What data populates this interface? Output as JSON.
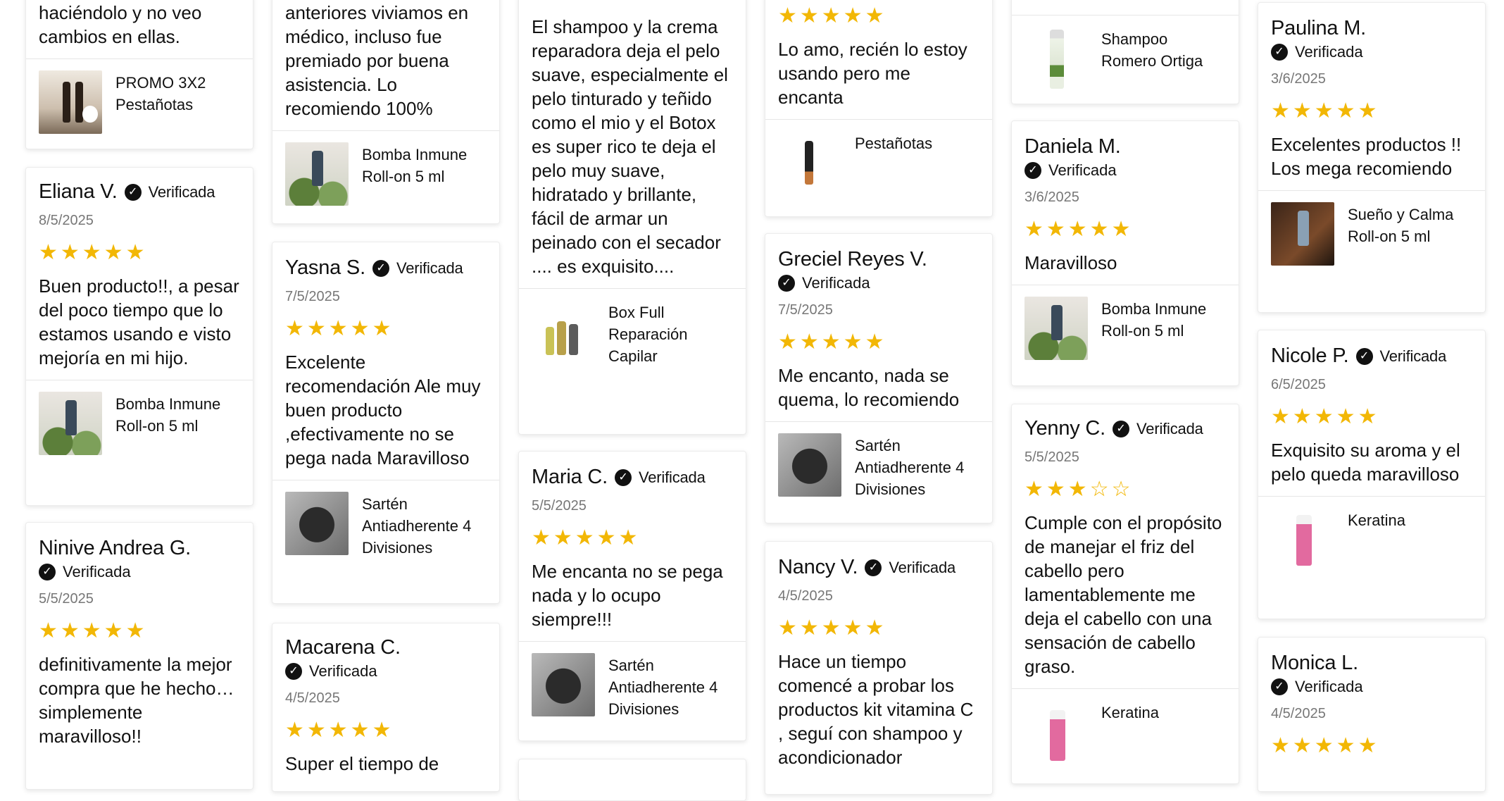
{
  "verified_label": "Verificada",
  "columns": [
    {
      "cards": [
        {
          "top_partial_text": "haciéndolo y no veo cambios en ellas.",
          "product": "PROMO 3X2 Pestañotas",
          "thumb": "bottles"
        },
        {
          "name": "Eliana V.",
          "verified_inline": true,
          "date": "8/5/2025",
          "stars": "★★★★★",
          "text": "Buen producto!!, a pesar del poco tiempo que lo estamos usando e visto mejoría en mi hijo.",
          "product": "Bomba Inmune Roll-on 5 ml",
          "thumb": "plant"
        },
        {
          "name": "Ninive Andrea G.",
          "verified_inline": false,
          "date": "5/5/2025",
          "stars": "★★★★★",
          "text": "definitivamente la mejor compra que he hecho… simplemente maravilloso!!"
        }
      ]
    },
    {
      "cards": [
        {
          "top_partial_text": "anteriores viviamos en médico, incluso fue premiado por buena asistencia. Lo recomiendo 100%",
          "product": "Bomba Inmune Roll-on 5 ml",
          "thumb": "plant"
        },
        {
          "name": "Yasna S.",
          "verified_inline": true,
          "date": "7/5/2025",
          "stars": "★★★★★",
          "text": "Excelente recomendación Ale muy buen producto ,efectivamente no se pega nada Maravilloso",
          "product": "Sartén Antiadherente 4 Divisiones",
          "thumb": "pan"
        },
        {
          "name": "Macarena C.",
          "verified_inline": false,
          "date": "4/5/2025",
          "stars": "★★★★★",
          "text": "Super el tiempo de"
        }
      ]
    },
    {
      "cards": [
        {
          "top_partial_text": "El shampoo y la crema reparadora deja el pelo suave, especialmente el pelo tinturado y teñido como el mio y el Botox es super rico te deja el pelo  muy suave, hidratado y brillante, fácil de armar un peinado con el secador .... es exquisito....",
          "product": "Box Full Reparación Capilar",
          "thumb": "bottles-white"
        },
        {
          "name": "Maria C.",
          "verified_inline": true,
          "date": "5/5/2025",
          "stars": "★★★★★",
          "text": "Me encanta no se pega nada y lo ocupo siempre!!!",
          "product": "Sartén Antiadherente 4 Divisiones",
          "thumb": "pan"
        },
        {
          "empty": true
        }
      ]
    },
    {
      "cards": [
        {
          "top_stars": "★★★★★",
          "top_partial_text": "Lo amo, recién lo estoy usando pero me encanta",
          "product": "Pestañotas",
          "thumb": "single"
        },
        {
          "name": "Greciel Reyes V.",
          "verified_inline": false,
          "date": "7/5/2025",
          "stars": "★★★★★",
          "text": "Me encanto, nada se quema, lo recomiendo",
          "product": "Sartén Antiadherente 4 Divisiones",
          "thumb": "pan"
        },
        {
          "name": "Nancy V.",
          "verified_inline": true,
          "date": "4/5/2025",
          "stars": "★★★★★",
          "text": "Hace un tiempo comencé a probar los productos kit vitamina C , seguí con shampoo y acondicionador"
        }
      ]
    },
    {
      "cards": [
        {
          "product": "Shampoo Romero Ortiga",
          "thumb": "green-bottle"
        },
        {
          "name": "Daniela M.",
          "verified_inline": false,
          "date": "3/6/2025",
          "stars": "★★★★★",
          "text": "Maravilloso",
          "product": "Bomba Inmune Roll-on 5 ml",
          "thumb": "plant"
        },
        {
          "name": "Yenny C.",
          "verified_inline": true,
          "date": "5/5/2025",
          "stars_on": "★★★",
          "stars_off": "☆☆",
          "text": "Cumple con el propósito de manejar el friz del cabello pero lamentablemente me deja el cabello con una sensación de cabello graso.",
          "product": "Keratina",
          "thumb": "pink"
        }
      ]
    },
    {
      "cards": [
        {
          "name": "Paulina M.",
          "verified_inline": false,
          "date": "3/6/2025",
          "stars": "★★★★★",
          "text": "Excelentes productos !!\nLos mega recomiendo",
          "product": "Sueño y Calma Roll-on 5 ml",
          "thumb": "dark"
        },
        {
          "name": "Nicole P.",
          "verified_inline": true,
          "date": "6/5/2025",
          "stars": "★★★★★",
          "text": "Exquisito su aroma y el pelo queda maravilloso",
          "product": "Keratina",
          "thumb": "pink"
        },
        {
          "name": "Monica L.",
          "verified_inline": false,
          "date": "4/5/2025",
          "stars": "★★★★★"
        }
      ]
    }
  ]
}
